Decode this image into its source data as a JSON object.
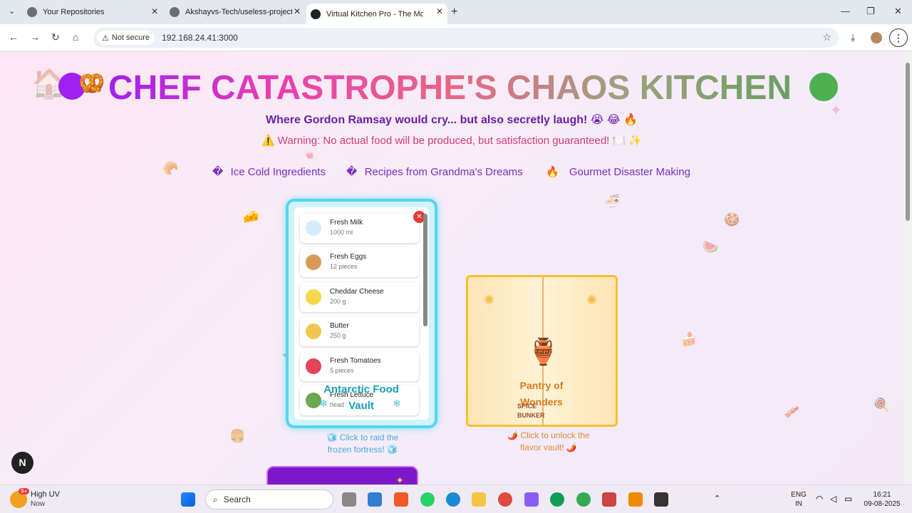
{
  "browser": {
    "tabs": [
      {
        "title": "Your Repositories"
      },
      {
        "title": "Akshayvs-Tech/useless-project-"
      },
      {
        "title": "Virtual Kitchen Pro - The Most U"
      }
    ],
    "new_tab": "+",
    "minimize": "—",
    "maximize": "❐",
    "close": "✕",
    "security_label": "Not secure",
    "url": "192.168.24.41:3000"
  },
  "page": {
    "title": "CHEF CATASTROPHE'S CHAOS KITCHEN",
    "subtitle": "Where Gordon Ramsay would cry... but also secretly laugh! 😭 😂 🔥",
    "warning": "⚠️ Warning: No actual food will be produced, but satisfaction guaranteed! 🍽️ ✨",
    "features": [
      {
        "icon": "�",
        "label": "Ice Cold Ingredients"
      },
      {
        "icon": "�",
        "label": "Recipes from Grandma's Dreams"
      },
      {
        "icon": "🔥",
        "label": "Gourmet Disaster Making"
      }
    ],
    "fridge": {
      "items": [
        {
          "name": "Fresh Milk",
          "qty": "1000 ml",
          "color": "#d6ecfb"
        },
        {
          "name": "Fresh Eggs",
          "qty": "12 pieces",
          "color": "#d89a5a"
        },
        {
          "name": "Cheddar Cheese",
          "qty": "200 g",
          "color": "#f7d64a"
        },
        {
          "name": "Butter",
          "qty": "250 g",
          "color": "#f2c64e"
        },
        {
          "name": "Fresh Tomatoes",
          "qty": "5 pieces",
          "color": "#e2445a"
        },
        {
          "name": "Fresh Lettuce",
          "qty": "head",
          "color": "#6aa84f"
        }
      ],
      "close_label": "✕",
      "label": "Antarctic Food Vault",
      "caption": "🧊 Click to raid the frozen fortress! 🧊"
    },
    "pantry": {
      "label": "Pantry of Wonders",
      "spice_label": "SPICE BUNKER",
      "caption": "🌶️ Click to unlock the flavor vault! 🌶️"
    },
    "next_button": "N"
  },
  "taskbar": {
    "weather_badge": "9+",
    "weather_title": "High UV",
    "weather_sub": "Now",
    "search_placeholder": "Search",
    "lang": "ENG",
    "region": "IN",
    "time": "16:21",
    "date": "09-08-2025"
  }
}
